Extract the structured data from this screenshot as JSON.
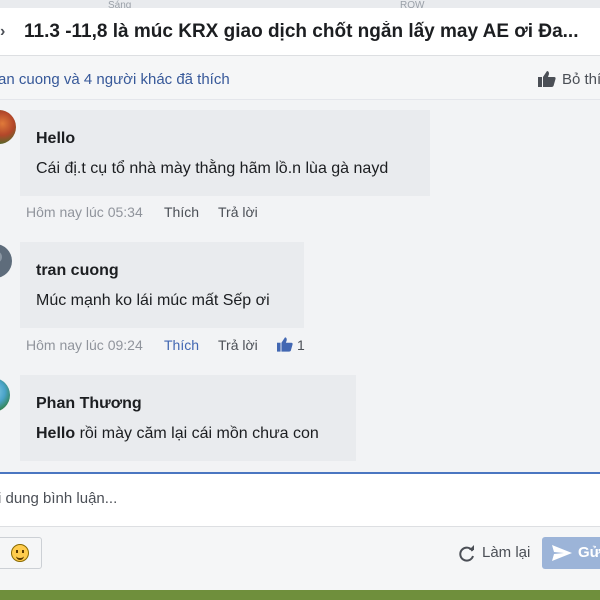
{
  "browser_chrome": {
    "hint_left": "Sáng",
    "hint_right": "ROW"
  },
  "dialog": {
    "title": "11.3 -11,8 là múc KRX giao dịch chốt ngắn lấy may AE ơi Đa...",
    "likes_summary": "an cuong và 4 người khác đã thích",
    "unlike_label": "Bỏ thích"
  },
  "comments": [
    {
      "author": "Hello",
      "text_bold": "",
      "text": "Cái đị.t cụ tổ nhà mày thằng hãm lồ.n lùa gà nayd",
      "time": "Hôm nay lúc 05:34",
      "like_label": "Thích",
      "liked": false,
      "reply_label": "Trả lời",
      "like_count": ""
    },
    {
      "author": "tran cuong",
      "text_bold": "",
      "text": "Múc mạnh ko lái múc mất Sếp ơi",
      "time": "Hôm nay lúc 09:24",
      "like_label": "Thích",
      "liked": true,
      "reply_label": "Trả lời",
      "like_count": "1"
    },
    {
      "author": "Phan Thương",
      "text_bold": "Hello",
      "text": " rồi mày căm lại cái mồn chưa con",
      "time": "",
      "like_label": "",
      "liked": false,
      "reply_label": "",
      "like_count": ""
    }
  ],
  "composer": {
    "placeholder": "i dung bình luận...",
    "value": "",
    "emoji_icon": "smiley-emoji-icon",
    "reset_label": "Làm lại",
    "send_label": "Gửi"
  },
  "colors": {
    "accent": "#4267b2",
    "link": "#365899",
    "bubble": "#e9ebee",
    "send_disabled": "#9cb4d8"
  }
}
